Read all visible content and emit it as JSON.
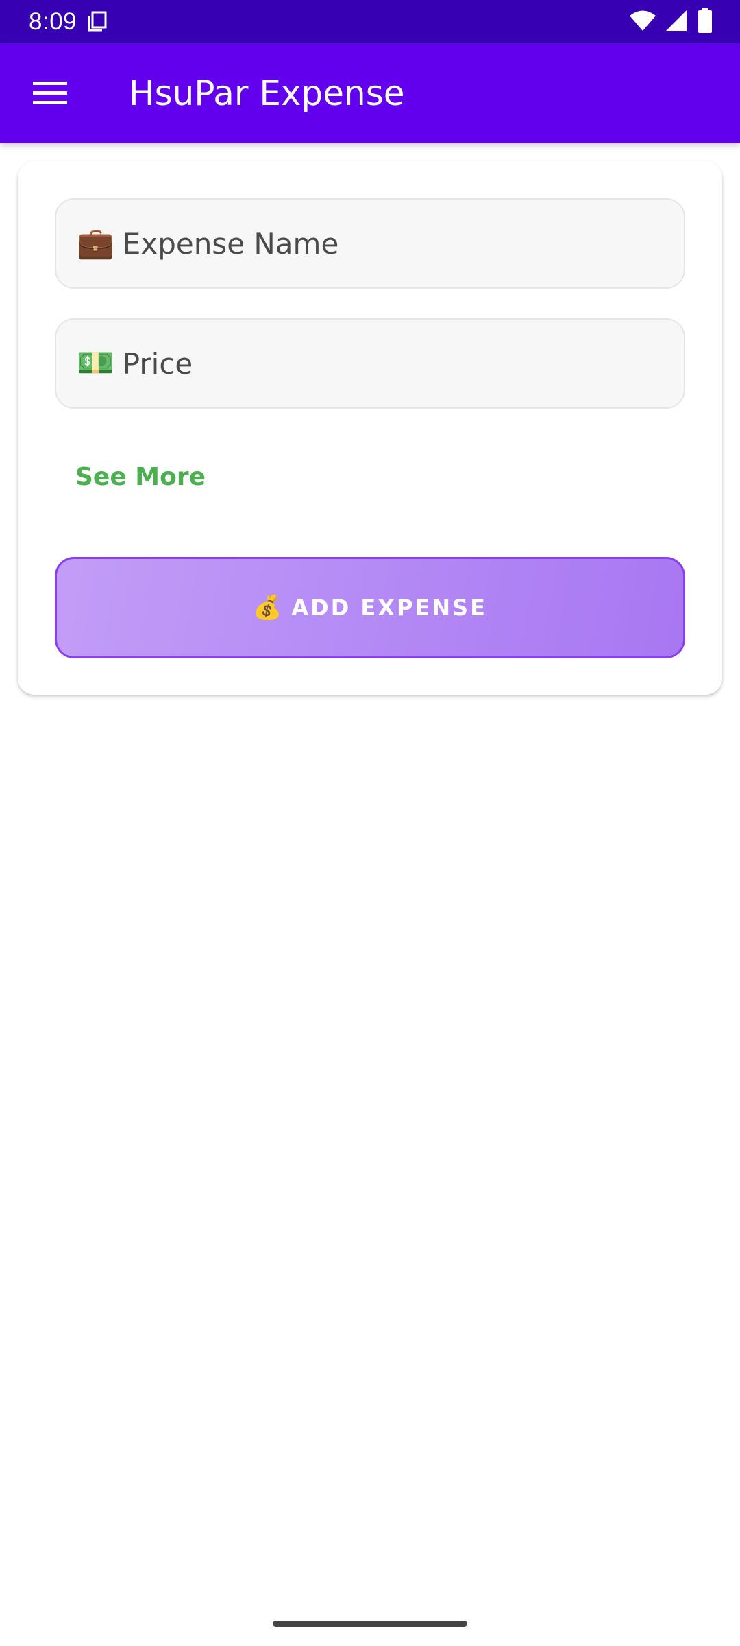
{
  "status_bar": {
    "time": "8:09",
    "icons": [
      "screenshot-icon",
      "wifi-icon",
      "signal-icon",
      "battery-icon"
    ]
  },
  "app_bar": {
    "title": "HsuPar Expense",
    "menu_icon": "hamburger-menu-icon",
    "color": "#6200ee"
  },
  "form": {
    "expense_name": {
      "emoji": "💼",
      "placeholder": "Expense Name",
      "value": ""
    },
    "price": {
      "emoji": "💵",
      "placeholder": "Price",
      "value": ""
    },
    "see_more_label": "See More",
    "add_button": {
      "emoji": "💰",
      "label": "ADD EXPENSE"
    }
  },
  "colors": {
    "status_bar": "#3700b3",
    "app_bar": "#6200ee",
    "see_more": "#4caf50",
    "add_button_border": "#8a3ff0"
  }
}
